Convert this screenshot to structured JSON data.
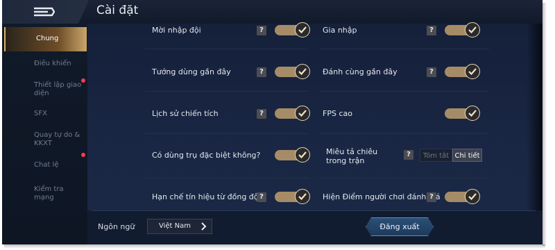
{
  "header": {
    "title": "Cài đặt",
    "back_icon": "back-arrow-icon"
  },
  "sidebar": {
    "items": [
      {
        "label": "Chung",
        "active": true,
        "badge": false
      },
      {
        "label": "Điều khiển",
        "active": false,
        "badge": false
      },
      {
        "label": "Thiết lập giao diện",
        "active": false,
        "badge": true
      },
      {
        "label": "SFX",
        "active": false,
        "badge": false
      },
      {
        "label": "Quay tự do & KKXT",
        "active": false,
        "badge": false
      },
      {
        "label": "Chat lệ",
        "active": false,
        "badge": true
      },
      {
        "label": "Kiểm tra mạng",
        "active": false,
        "badge": false
      }
    ]
  },
  "settings": {
    "left": [
      {
        "label": "Mời nhập đội",
        "help": "?",
        "enabled": true
      },
      {
        "label": "Tướng dùng gần đây",
        "help": "?",
        "enabled": true
      },
      {
        "label": "Lịch sử chiến tích",
        "help": "?",
        "enabled": true
      },
      {
        "label": "Có dùng trụ đặc biệt không?",
        "help": "",
        "enabled": true
      },
      {
        "label": "Hạn chế tín hiệu từ đồng đội",
        "help": "?",
        "enabled": true
      }
    ],
    "right": [
      {
        "label": "Gia nhập",
        "help": "?",
        "enabled": true
      },
      {
        "label": "Đánh cùng gần đây",
        "help": "?",
        "enabled": true
      },
      {
        "label": "FPS cao",
        "help": "",
        "enabled": true
      },
      {
        "label": "Miêu tả chiêu trong trận",
        "help": "?",
        "segmented": {
          "options": [
            "Tóm tắt",
            "Chi tiết"
          ],
          "selected": "Chi tiết"
        }
      },
      {
        "label": "Hiện Điểm người chơi đánh giá",
        "help": "?",
        "enabled": true
      }
    ]
  },
  "footer": {
    "language_label": "Ngôn ngữ",
    "language_value": "Việt Nam",
    "logout_label": "Đăng xuất"
  },
  "colors": {
    "toggle_track": "#a68c66",
    "toggle_knob": "#2a2a2c",
    "active_tab": "#caa56a",
    "badge": "#ff3a4c",
    "logout_bg": "#2b4f76"
  }
}
